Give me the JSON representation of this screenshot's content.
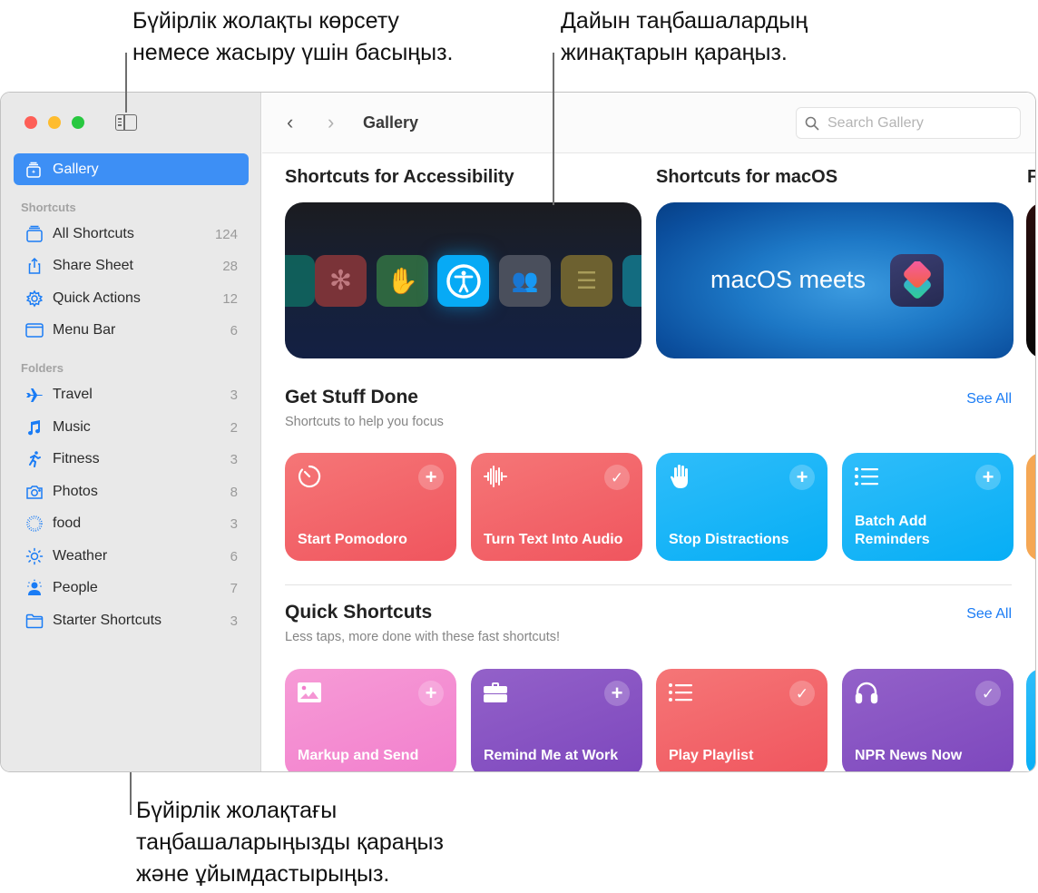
{
  "callouts": {
    "sidebar_toggle": [
      "Бүйірлік жолақты көрсету",
      "немесе жасыру үшін басыңыз."
    ],
    "gallery_collections": [
      "Дайын таңбашалардың",
      "жинақтарын қараңыз."
    ],
    "sidebar_shortcuts": [
      "Бүйірлік жолақтағы",
      "таңбашаларыңызды қараңыз",
      "және ұйымдастырыңыз."
    ]
  },
  "sidebar": {
    "gallery": {
      "label": "Gallery",
      "icon": "gallery-icon",
      "selected": true
    },
    "shortcuts_label": "Shortcuts",
    "shortcuts": [
      {
        "label": "All Shortcuts",
        "count": "124",
        "icon": "stack-icon"
      },
      {
        "label": "Share Sheet",
        "count": "28",
        "icon": "share-icon"
      },
      {
        "label": "Quick Actions",
        "count": "12",
        "icon": "gear-icon"
      },
      {
        "label": "Menu Bar",
        "count": "6",
        "icon": "menubar-icon"
      }
    ],
    "folders_label": "Folders",
    "folders": [
      {
        "label": "Travel",
        "count": "3",
        "icon": "airplane-icon"
      },
      {
        "label": "Music",
        "count": "2",
        "icon": "music-note-icon"
      },
      {
        "label": "Fitness",
        "count": "3",
        "icon": "running-figure-icon"
      },
      {
        "label": "Photos",
        "count": "8",
        "icon": "camera-icon"
      },
      {
        "label": "food",
        "count": "3",
        "icon": "dotted-circle-icon"
      },
      {
        "label": "Weather",
        "count": "6",
        "icon": "sun-icon"
      },
      {
        "label": "People",
        "count": "7",
        "icon": "person-icon"
      },
      {
        "label": "Starter Shortcuts",
        "count": "3",
        "icon": "folder-icon"
      }
    ]
  },
  "toolbar": {
    "title": "Gallery",
    "back_label": "‹",
    "forward_label": "›",
    "search_placeholder": "Search Gallery",
    "search_value": ""
  },
  "collections": [
    {
      "title": "Shortcuts for Accessibility"
    },
    {
      "title": "Shortcuts for macOS",
      "banner_text": "macOS meets"
    },
    {
      "title": "F"
    }
  ],
  "sections": [
    {
      "title": "Get Stuff Done",
      "subtitle": "Shortcuts to help you focus",
      "see_all": "See All",
      "cards": [
        {
          "title": "Start Pomodoro",
          "icon": "timer-icon",
          "action": "add",
          "color": "#f0555e"
        },
        {
          "title": "Turn Text Into Audio",
          "icon": "waveform-icon",
          "action": "added",
          "color": "#f0555e"
        },
        {
          "title": "Stop Distractions",
          "icon": "hand-icon",
          "action": "add",
          "color": "#06aef5"
        },
        {
          "title": "Batch Add Reminders",
          "icon": "list-icon",
          "action": "add",
          "color": "#06aef5"
        }
      ]
    },
    {
      "title": "Quick Shortcuts",
      "subtitle": "Less taps, more done with these fast shortcuts!",
      "see_all": "See All",
      "cards": [
        {
          "title": "Markup and Send",
          "icon": "photo-icon",
          "action": "add",
          "color": "#f27fcd"
        },
        {
          "title": "Remind Me at Work",
          "icon": "briefcase-icon",
          "action": "add",
          "color": "#7d47bd"
        },
        {
          "title": "Play Playlist",
          "icon": "list-icon",
          "action": "added",
          "color": "#f0555e"
        },
        {
          "title": "NPR News Now",
          "icon": "headphones-icon",
          "action": "added",
          "color": "#7d47bd"
        }
      ]
    }
  ],
  "colors": {
    "accent": "#1a7cf5",
    "selection": "#3d8ff5"
  }
}
